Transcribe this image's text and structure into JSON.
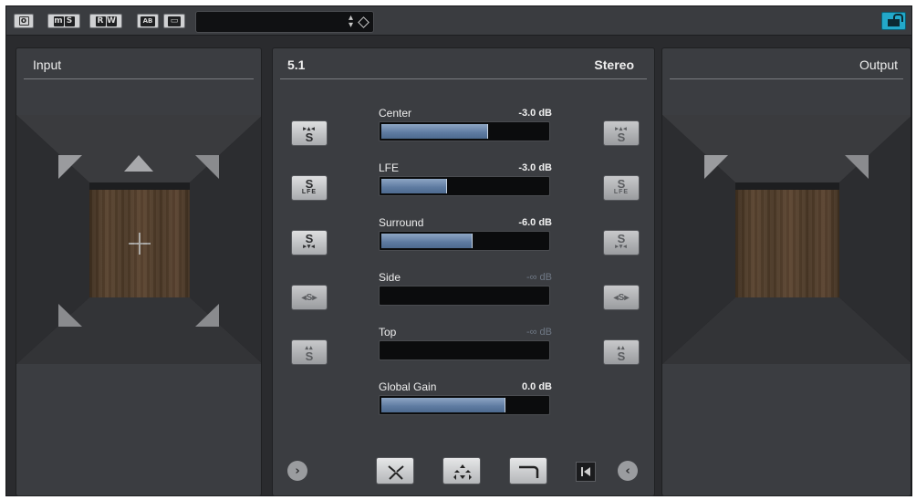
{
  "toolbar": {
    "buttons": [
      {
        "name": "bypass",
        "glyphs": [
          "ö"
        ]
      },
      {
        "name": "monitor",
        "glyphs": [
          "m",
          "S"
        ]
      },
      {
        "name": "automation",
        "glyphs": [
          "R",
          "W"
        ]
      },
      {
        "name": "compare",
        "glyphs": [
          "AB"
        ]
      },
      {
        "name": "settings",
        "glyphs": [
          "▭"
        ]
      }
    ],
    "preset": {
      "value": ""
    },
    "lock_color": "#23a8c9"
  },
  "input_panel": {
    "title": "Input"
  },
  "middle_panel": {
    "source_format": "5.1",
    "target_format": "Stereo",
    "params": [
      {
        "label": "Center",
        "value": "-3.0 dB",
        "level": 0.65,
        "active": true
      },
      {
        "label": "LFE",
        "value": "-3.0 dB",
        "level": 0.41,
        "active": true
      },
      {
        "label": "Surround",
        "value": "-6.0 dB",
        "level": 0.56,
        "active": true
      },
      {
        "label": "Side",
        "value": "-∞ dB",
        "level": 0,
        "active": false
      },
      {
        "label": "Top",
        "value": "-∞ dB",
        "level": 0,
        "active": false
      },
      {
        "label": "Global Gain",
        "value": "0.0 dB",
        "level": 0.75,
        "active": true
      }
    ],
    "channel_buttons": [
      {
        "top": "▸▴◂",
        "main": "S",
        "sub": ""
      },
      {
        "top": "",
        "main": "S",
        "sub": "LFE"
      },
      {
        "top": "",
        "main": "S",
        "sub": "▸▾◂"
      },
      {
        "top": "",
        "main": "◂S▸",
        "sub": ""
      },
      {
        "top": "▴▴",
        "main": "S",
        "sub": ""
      }
    ],
    "accent_color": "#5d7aa0"
  },
  "output_panel": {
    "title": "Output"
  }
}
